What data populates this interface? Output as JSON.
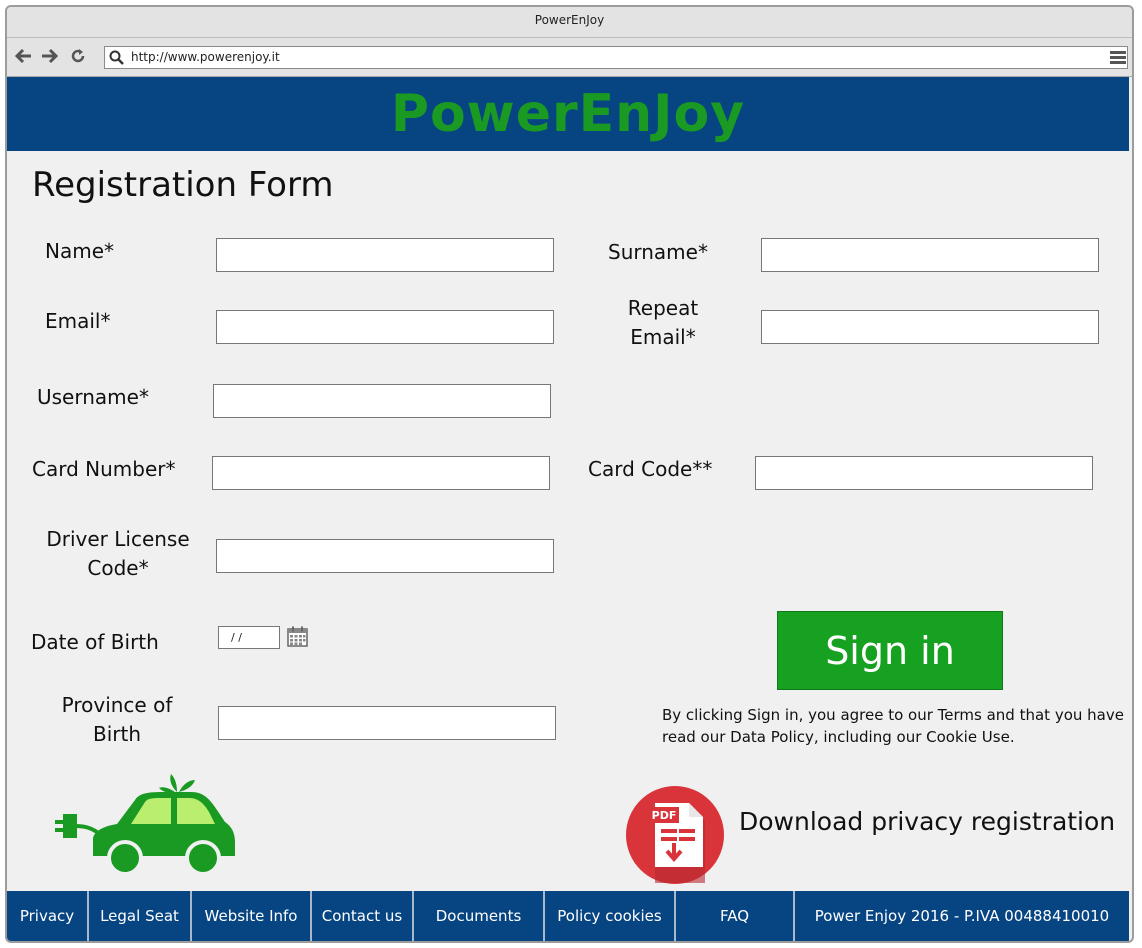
{
  "window": {
    "title": "PowerEnJoy"
  },
  "browser": {
    "url": "http://www.powerenjoy.it",
    "icons": [
      "arrow-left-icon",
      "arrow-right-icon",
      "refresh-icon",
      "search-icon",
      "menu-icon"
    ]
  },
  "banner": {
    "title": "PowerEnJoy"
  },
  "form": {
    "title": "Registration Form",
    "name_label": "Name*",
    "surname_label": "Surname*",
    "email_label": "Email*",
    "repeat_email_label_1": "Repeat",
    "repeat_email_label_2": "Email*",
    "username_label": "Username*",
    "card_number_label": "Card Number*",
    "card_code_label": "Card Code**",
    "license_label_1": "Driver License",
    "license_label_2": "Code*",
    "dob_label": "Date of Birth",
    "dob_value": "/ /",
    "province_label_1": "Province of",
    "province_label_2": "Birth"
  },
  "signin": {
    "button_label": "Sign in",
    "terms_text": "By clicking Sign in, you agree to our Terms and that you have read our Data Policy, including our Cookie Use."
  },
  "download": {
    "label": "Download privacy registration",
    "badge": "PDF"
  },
  "footer": {
    "items": [
      "Privacy",
      "Legal Seat",
      "Website Info",
      "Contact us",
      "Documents",
      "Policy cookies",
      "FAQ",
      "Power Enjoy 2016 - P.IVA 00488410010"
    ]
  },
  "colors": {
    "banner_bg": "#064482",
    "brand_green": "#1a9a22",
    "button_green": "#17a121",
    "pdf_red": "#d9343a",
    "page_bg": "#f0f0f0"
  }
}
